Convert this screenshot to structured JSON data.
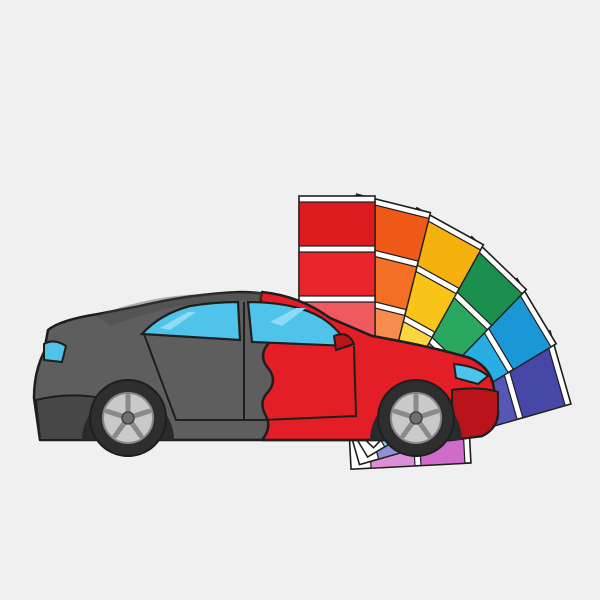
{
  "illustration": {
    "background_color": "#f0f0f0",
    "car_colors": {
      "body_gray": "#5e5e5e",
      "body_gray_dark": "#474747",
      "body_red": "#e31e26",
      "body_red_dark": "#b8141a",
      "window_blue": "#4fc3ea",
      "window_blue_light": "#8ddbf5",
      "tire": "#2e2e2e",
      "rim": "#c9c9c9",
      "outline": "#1e1e1e"
    },
    "swatch_fan": {
      "strips": [
        {
          "name": "red-strip",
          "colors": [
            "#f27a7f",
            "#ee5a60",
            "#e8262b",
            "#dc1b1f"
          ]
        },
        {
          "name": "orange-strip",
          "colors": [
            "#f9a979",
            "#f68d4f",
            "#f36f25",
            "#ef5a18"
          ]
        },
        {
          "name": "yellow-strip",
          "colors": [
            "#fde472",
            "#fcd63f",
            "#f9c318",
            "#f5b10d"
          ]
        },
        {
          "name": "green-strip",
          "colors": [
            "#79d19b",
            "#4dbf7b",
            "#2aa860",
            "#1a8f4e"
          ]
        },
        {
          "name": "cyan-strip",
          "colors": [
            "#79d4f5",
            "#4cc2ee",
            "#29aee4",
            "#1a98d6"
          ]
        },
        {
          "name": "purple-strip",
          "colors": [
            "#8f8fd8",
            "#6e6ec9",
            "#5656b8",
            "#4747a8"
          ]
        },
        {
          "name": "pink-strip",
          "colors": [
            "#dc8fd6",
            "#cf6bc8"
          ]
        }
      ]
    }
  }
}
